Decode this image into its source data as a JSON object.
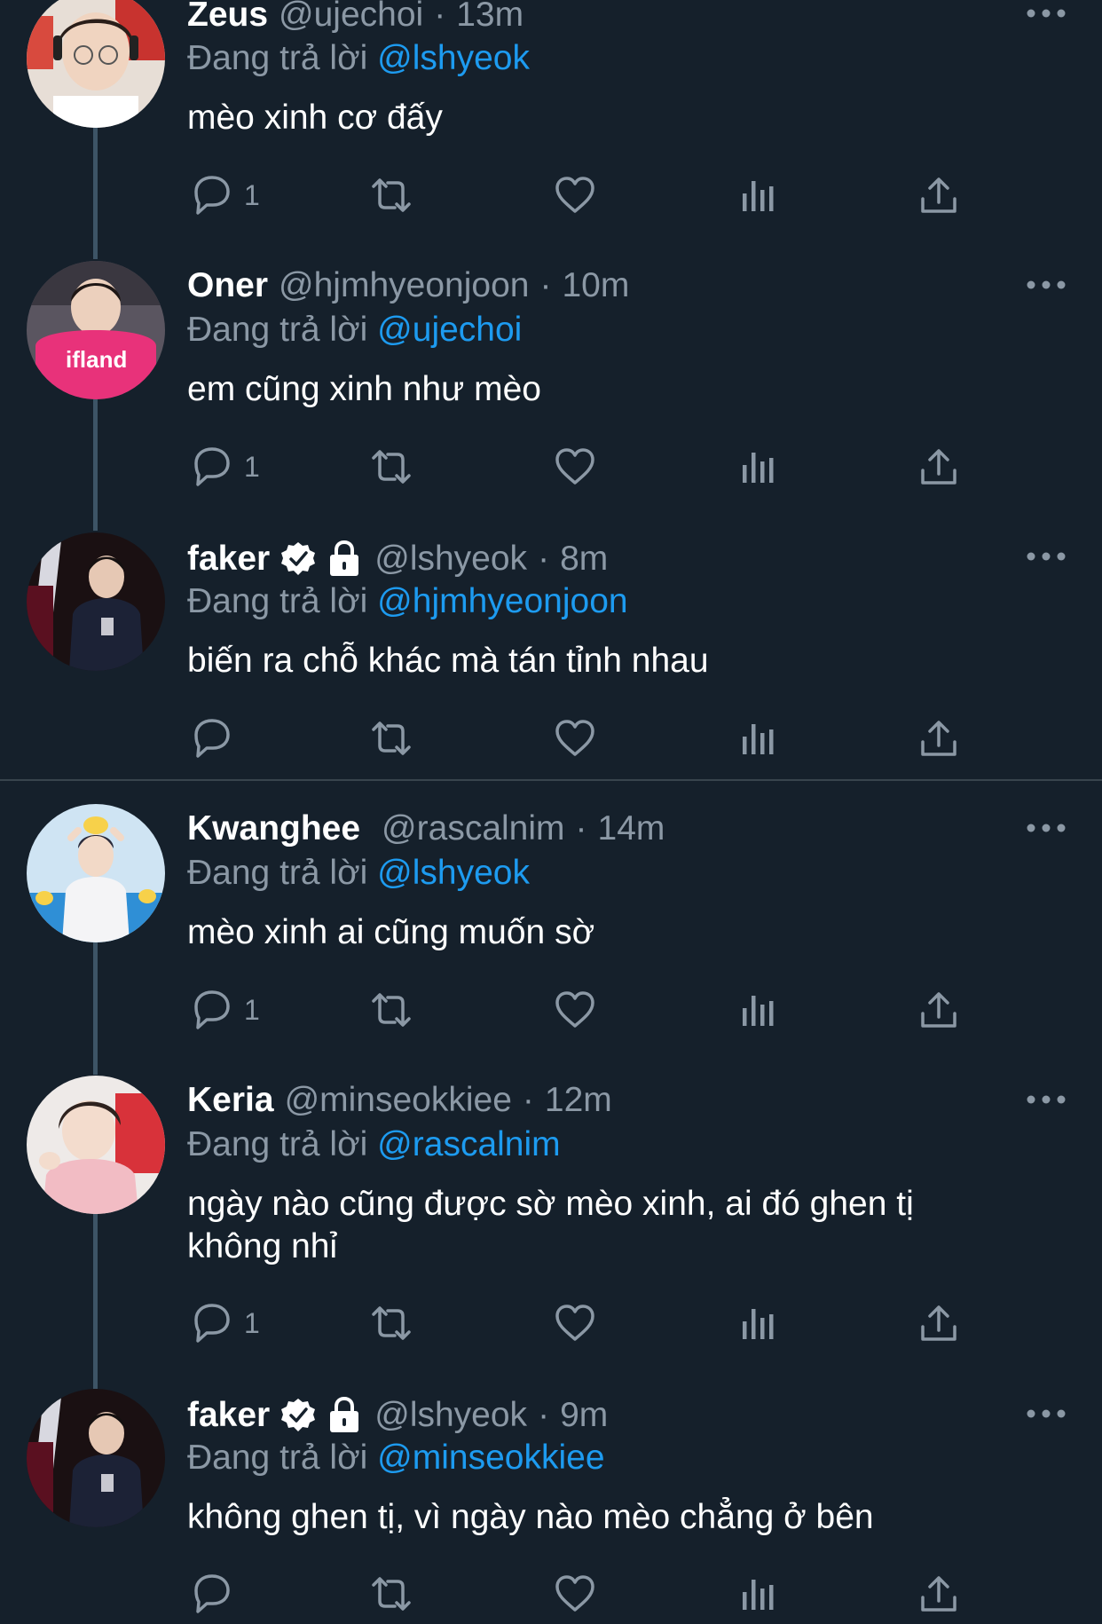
{
  "reply_prefix": "Đang trả lời",
  "tweets": [
    {
      "name": "Zeus",
      "handle": "@ujechoi",
      "time": "13m",
      "reply_to": "@lshyeok",
      "text": "mèo xinh cơ đấy",
      "reply_count": "1",
      "verified": false,
      "protected": false
    },
    {
      "name": "Oner",
      "handle": "@hjmhyeonjoon",
      "time": "10m",
      "reply_to": "@ujechoi",
      "text": "em cũng xinh như mèo",
      "reply_count": "1",
      "verified": false,
      "protected": false
    },
    {
      "name": "faker",
      "handle": "@lshyeok",
      "time": "8m",
      "reply_to": "@hjmhyeonjoon",
      "text": "biến ra chỗ khác mà tán tỉnh nhau",
      "reply_count": "",
      "verified": true,
      "protected": true
    },
    {
      "name": "Kwanghee",
      "handle": "@rascalnim",
      "time": "14m",
      "reply_to": "@lshyeok",
      "text": "mèo xinh ai cũng muốn sờ",
      "reply_count": "1",
      "verified": false,
      "protected": false
    },
    {
      "name": "Keria",
      "handle": "@minseokkiee",
      "time": "12m",
      "reply_to": "@rascalnim",
      "text": "ngày nào cũng được sờ mèo xinh, ai đó ghen tị không nhỉ",
      "reply_count": "1",
      "verified": false,
      "protected": false
    },
    {
      "name": "faker",
      "handle": "@lshyeok",
      "time": "9m",
      "reply_to": "@minseokkiee",
      "text": "không ghen tị, vì ngày nào mèo chẳng ở bên",
      "reply_count": "",
      "verified": true,
      "protected": true
    }
  ],
  "icons": {
    "reply": "reply-icon",
    "retweet": "retweet-icon",
    "like": "heart-icon",
    "views": "views-icon",
    "share": "share-icon",
    "more": "more-icon",
    "verified": "verified-badge-icon",
    "protected": "lock-icon"
  },
  "colors": {
    "background": "#15202b",
    "text": "#ffffff",
    "secondary": "#8b98a5",
    "link": "#1d9bf0",
    "thread_line": "#3d5466",
    "divider": "#38444d"
  }
}
